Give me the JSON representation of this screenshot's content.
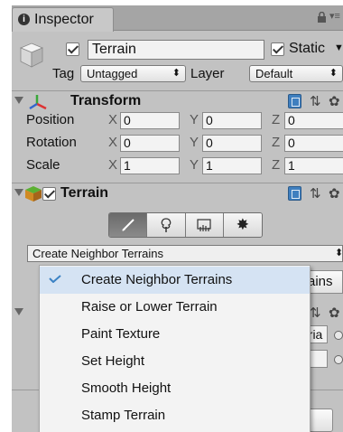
{
  "tab": {
    "label": "Inspector",
    "icon": "info-icon"
  },
  "header": {
    "object_name": "Terrain",
    "static_label": "Static",
    "tag_label": "Tag",
    "tag_value": "Untagged",
    "layer_label": "Layer",
    "layer_value": "Default"
  },
  "transform": {
    "title": "Transform",
    "rows": [
      {
        "label": "Position",
        "x": "0",
        "y": "0",
        "z": "0"
      },
      {
        "label": "Rotation",
        "x": "0",
        "y": "0",
        "z": "0"
      },
      {
        "label": "Scale",
        "x": "1",
        "y": "1",
        "z": "1"
      }
    ],
    "axes": {
      "x": "X",
      "y": "Y",
      "z": "Z"
    }
  },
  "terrain": {
    "title": "Terrain",
    "tools": [
      "paint-brush-icon",
      "tree-icon",
      "detail-grass-icon",
      "settings-gear-icon"
    ],
    "active_tool": 0,
    "mode_select": "Create Neighbor Terrains",
    "behind_button": "rains",
    "behind_field": "eria"
  },
  "menu": {
    "selected_index": 0,
    "items": [
      "Create Neighbor Terrains",
      "Raise or Lower Terrain",
      "Paint Texture",
      "Set Height",
      "Smooth Height",
      "Stamp Terrain"
    ]
  },
  "colors": {
    "panel_bg": "#c2c2c2",
    "menu_selected": "#d5e3f3",
    "check_blue": "#3b82c4"
  }
}
